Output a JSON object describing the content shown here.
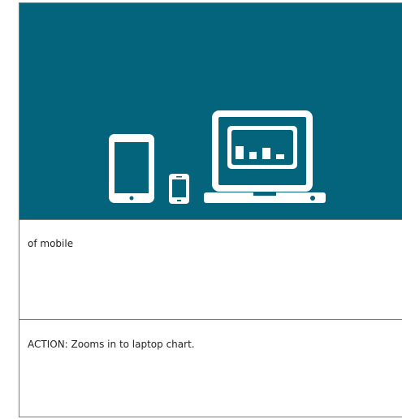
{
  "hero": {
    "background_color": "#03647c",
    "icon_color": "#ffffff",
    "icons": [
      "tablet-icon",
      "phone-icon",
      "laptop-icon",
      "bar-chart-icon"
    ]
  },
  "rows": [
    {
      "text": "of mobile"
    },
    {
      "text": "ACTION: Zooms in to laptop chart."
    }
  ]
}
